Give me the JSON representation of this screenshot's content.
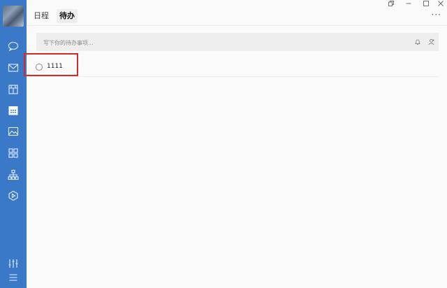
{
  "sidebar": {
    "items": [
      {
        "icon": "chat-bubble-icon"
      },
      {
        "icon": "mail-icon"
      },
      {
        "icon": "box-icon"
      },
      {
        "icon": "calendar-icon",
        "active": true
      },
      {
        "icon": "image-icon"
      },
      {
        "icon": "apps-grid-icon"
      },
      {
        "icon": "org-chart-icon"
      },
      {
        "icon": "hexagon-icon"
      }
    ],
    "bottom": [
      {
        "icon": "sliders-icon"
      },
      {
        "icon": "menu-icon"
      }
    ]
  },
  "tabs": [
    {
      "label": "日程",
      "active": false
    },
    {
      "label": "待办",
      "active": true
    }
  ],
  "more_label": "···",
  "todo_input": {
    "placeholder": "写下你的待办事项..."
  },
  "todos": [
    {
      "text": "1111",
      "done": false
    }
  ],
  "colors": {
    "sidebar": "#3a78c8",
    "highlight": "#d32b2b"
  }
}
